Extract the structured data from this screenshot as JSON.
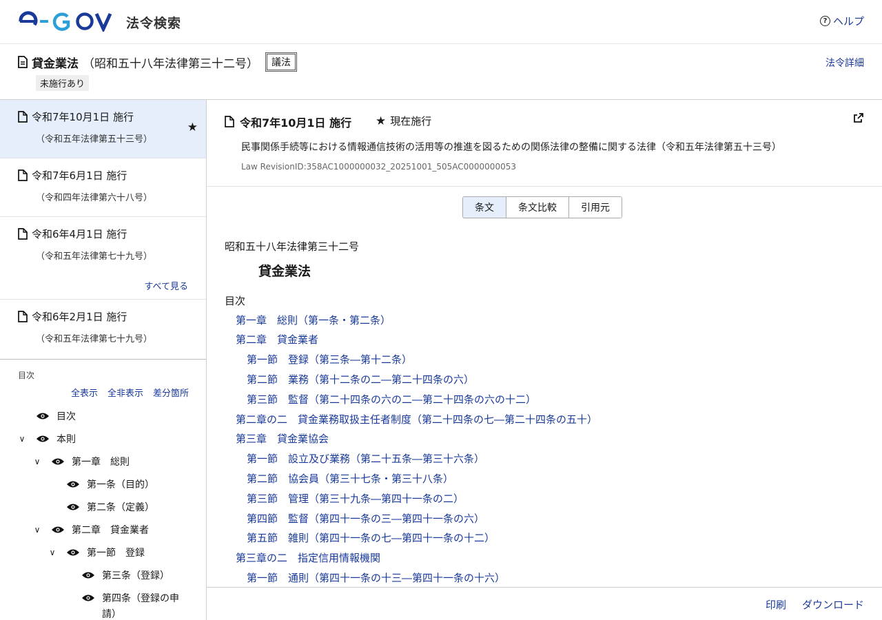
{
  "header": {
    "logo_text": "e-GOV",
    "app_title": "法令検索",
    "help_label": "ヘルプ",
    "help_icon": "question-circle-icon"
  },
  "law": {
    "title": "貸金業法",
    "number": "（昭和五十八年法律第三十二号）",
    "giho_badge": "議法",
    "pending_badge": "未施行あり",
    "detail_link": "法令詳細"
  },
  "revisions": [
    {
      "date": "令和7年10月1日 施行",
      "sub": "（令和五年法律第五十三号）",
      "active": true,
      "starred": true
    },
    {
      "date": "令和7年6月1日 施行",
      "sub": "（令和四年法律第六十八号）",
      "active": false,
      "starred": false
    },
    {
      "date": "令和6年4月1日 施行",
      "sub": "（令和五年法律第七十九号）",
      "active": false,
      "starred": false
    },
    {
      "date": "令和6年2月1日 施行",
      "sub": "（令和五年法律第七十九号）",
      "active": false,
      "starred": false
    }
  ],
  "see_all": "すべて見る",
  "toc_panel": {
    "label": "目次",
    "show_all": "全表示",
    "hide_all": "全非表示",
    "diff": "差分箇所",
    "items": [
      {
        "label": "目次",
        "level": 0,
        "expandable": false
      },
      {
        "label": "本則",
        "level": 0,
        "expandable": true
      },
      {
        "label": "第一章　総則",
        "level": 1,
        "expandable": true
      },
      {
        "label": "第一条（目的）",
        "level": 2,
        "expandable": false
      },
      {
        "label": "第二条（定義）",
        "level": 2,
        "expandable": false
      },
      {
        "label": "第二章　貸金業者",
        "level": 1,
        "expandable": true
      },
      {
        "label": "第一節　登録",
        "level": 2,
        "expandable": true
      },
      {
        "label": "第三条（登録）",
        "level": 3,
        "expandable": false
      },
      {
        "label": "第四条（登録の申",
        "label2": "請）",
        "level": 3,
        "expandable": false
      }
    ]
  },
  "current_revision": {
    "date": "令和7年10月1日 施行",
    "status": "現在施行",
    "amend_title": "民事関係手続等における情報通信技術の活用等の推進を図るための関係法律の整備に関する法律（令和五年法律第五十三号）",
    "revision_id": "Law RevisionID:358AC1000000032_20251001_505AC0000000053"
  },
  "tabs": [
    {
      "label": "条文",
      "active": true
    },
    {
      "label": "条文比較",
      "active": false
    },
    {
      "label": "引用元",
      "active": false
    }
  ],
  "body": {
    "law_number": "昭和五十八年法律第三十二号",
    "law_name": "貸金業法",
    "toc_heading": "目次",
    "toc": [
      {
        "text": "第一章　総則（第一条・第二条）",
        "indent": 1
      },
      {
        "text": "第二章　貸金業者",
        "indent": 1
      },
      {
        "text": "第一節　登録（第三条―第十二条）",
        "indent": 2
      },
      {
        "text": "第二節　業務（第十二条の二―第二十四条の六）",
        "indent": 2
      },
      {
        "text": "第三節　監督（第二十四条の六の二―第二十四条の六の十二）",
        "indent": 2
      },
      {
        "text": "第二章の二　貸金業務取扱主任者制度（第二十四条の七―第二十四条の五十）",
        "indent": 1
      },
      {
        "text": "第三章　貸金業協会",
        "indent": 1
      },
      {
        "text": "第一節　設立及び業務（第二十五条―第三十六条）",
        "indent": 2
      },
      {
        "text": "第二節　協会員（第三十七条・第三十八条）",
        "indent": 2
      },
      {
        "text": "第三節　管理（第三十九条―第四十一条の二）",
        "indent": 2
      },
      {
        "text": "第四節　監督（第四十一条の三―第四十一条の六）",
        "indent": 2
      },
      {
        "text": "第五節　雑則（第四十一条の七―第四十一条の十二）",
        "indent": 2
      },
      {
        "text": "第三章の二　指定信用情報機関",
        "indent": 1
      },
      {
        "text": "第一節　通則（第四十一条の十三―第四十一条の十六）",
        "indent": 2
      }
    ]
  },
  "footer": {
    "print": "印刷",
    "download": "ダウンロード"
  },
  "colors": {
    "link": "#1a3a9a",
    "active_bg": "#e6eefb",
    "logo_blue": "#1a3a9a",
    "logo_cyan": "#2b9fd8"
  }
}
